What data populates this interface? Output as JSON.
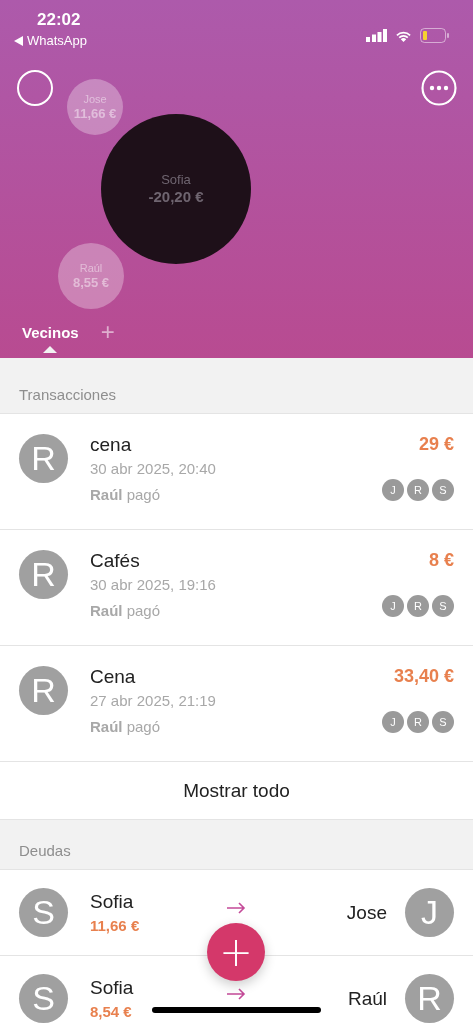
{
  "status_bar": {
    "time": "22:02",
    "back_app": "WhatsApp"
  },
  "bubbles": [
    {
      "name": "Jose",
      "amount": "11,66 €",
      "kind": "creditor"
    },
    {
      "name": "Sofia",
      "amount": "-20,20 €",
      "kind": "debtor"
    },
    {
      "name": "Raúl",
      "amount": "8,55 €",
      "kind": "creditor"
    }
  ],
  "tabs": [
    {
      "label": "Vecinos",
      "selected": true
    }
  ],
  "add_tab": "+",
  "transactions": {
    "title": "Transacciones",
    "items": [
      {
        "initial": "R",
        "title": "cena",
        "date": "30 abr 2025, 20:40",
        "payer": "**Raúl** pagó",
        "amount": "29 €",
        "participants": [
          "J",
          "R",
          "S"
        ]
      },
      {
        "initial": "R",
        "title": "Cafés",
        "date": "30 abr 2025, 19:16",
        "payer": "**Raúl** pagó",
        "amount": "8 €",
        "participants": [
          "J",
          "R",
          "S"
        ]
      },
      {
        "initial": "R",
        "title": "Cena",
        "date": "27 abr 2025, 21:19",
        "payer": "**Raúl** pagó",
        "amount": "33,40 €",
        "participants": [
          "J",
          "R",
          "S"
        ]
      }
    ],
    "show_all": "Mostrar todo"
  },
  "debts": {
    "title": "Deudas",
    "items": [
      {
        "from_initial": "S",
        "from": "Sofia",
        "amount": "11,66 €",
        "to": "Jose",
        "to_initial": "J"
      },
      {
        "from_initial": "S",
        "from": "Sofia",
        "amount": "8,54 €",
        "to": "Raúl",
        "to_initial": "R"
      }
    ]
  },
  "fab": "+"
}
